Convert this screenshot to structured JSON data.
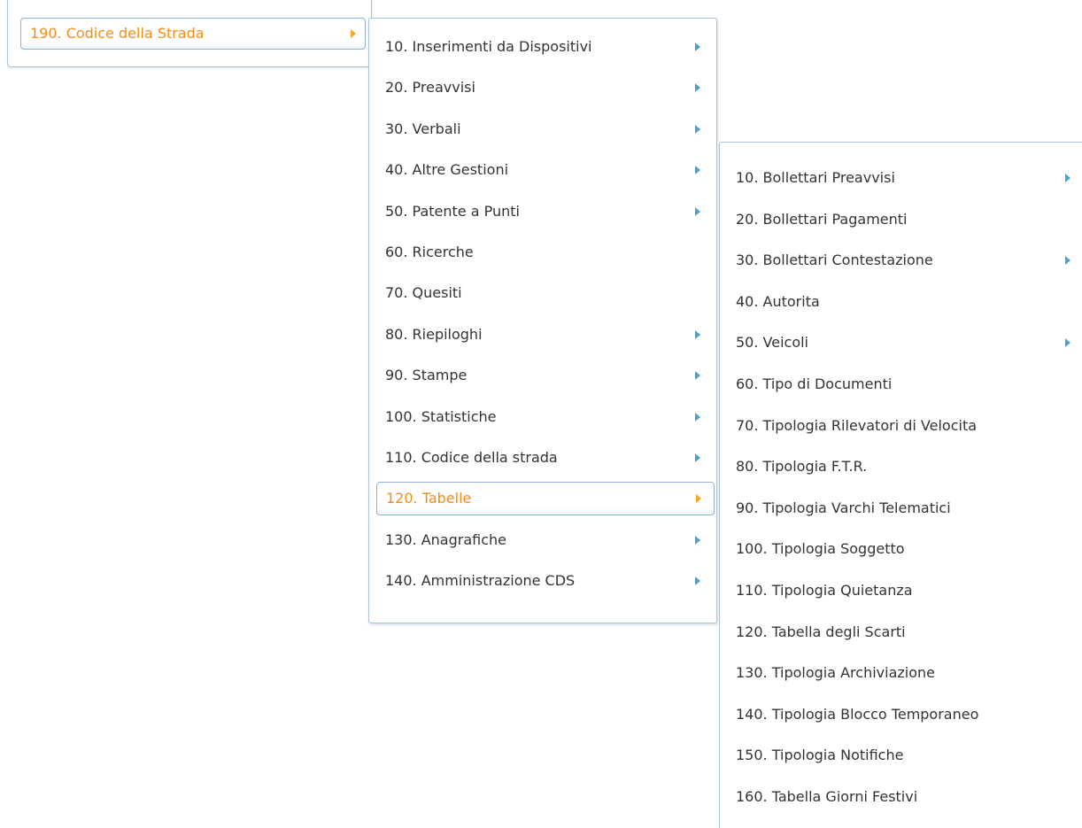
{
  "colors": {
    "text": "#333333",
    "active_text": "#f28c1a",
    "arrow": "#4a9fd8",
    "active_arrow": "#f5a623",
    "border": "#a9c1d9"
  },
  "menu_l1": {
    "items": [
      {
        "label": "190. Codice della Strada",
        "has_submenu": true,
        "active": true
      }
    ]
  },
  "menu_l2": {
    "items": [
      {
        "label": "10. Inserimenti da Dispositivi",
        "has_submenu": true
      },
      {
        "label": "20. Preavvisi",
        "has_submenu": true
      },
      {
        "label": "30. Verbali",
        "has_submenu": true
      },
      {
        "label": "40. Altre Gestioni",
        "has_submenu": true
      },
      {
        "label": "50. Patente a Punti",
        "has_submenu": true
      },
      {
        "label": "60. Ricerche",
        "has_submenu": false
      },
      {
        "label": "70. Quesiti",
        "has_submenu": false
      },
      {
        "label": "80. Riepiloghi",
        "has_submenu": true
      },
      {
        "label": "90. Stampe",
        "has_submenu": true
      },
      {
        "label": "100. Statistiche",
        "has_submenu": true
      },
      {
        "label": "110. Codice della strada",
        "has_submenu": true
      },
      {
        "label": "120. Tabelle",
        "has_submenu": true,
        "active": true
      },
      {
        "label": "130. Anagrafiche",
        "has_submenu": true
      },
      {
        "label": "140. Amministrazione CDS",
        "has_submenu": true
      }
    ]
  },
  "menu_l3": {
    "items": [
      {
        "label": "10. Bollettari Preavvisi",
        "has_submenu": true
      },
      {
        "label": "20. Bollettari Pagamenti",
        "has_submenu": false
      },
      {
        "label": "30. Bollettari Contestazione",
        "has_submenu": true
      },
      {
        "label": "40. Autorita",
        "has_submenu": false
      },
      {
        "label": "50. Veicoli",
        "has_submenu": true
      },
      {
        "label": "60. Tipo di Documenti",
        "has_submenu": false
      },
      {
        "label": "70. Tipologia Rilevatori di Velocita",
        "has_submenu": false
      },
      {
        "label": "80. Tipologia F.T.R.",
        "has_submenu": false
      },
      {
        "label": "90. Tipologia Varchi Telematici",
        "has_submenu": false
      },
      {
        "label": "100. Tipologia Soggetto",
        "has_submenu": false
      },
      {
        "label": "110. Tipologia Quietanza",
        "has_submenu": false
      },
      {
        "label": "120. Tabella degli Scarti",
        "has_submenu": false
      },
      {
        "label": "130. Tipologia Archiviazione",
        "has_submenu": false
      },
      {
        "label": "140. Tipologia Blocco Temporaneo",
        "has_submenu": false
      },
      {
        "label": "150. Tipologia Notifiche",
        "has_submenu": false
      },
      {
        "label": "160. Tabella Giorni Festivi",
        "has_submenu": false
      }
    ]
  }
}
